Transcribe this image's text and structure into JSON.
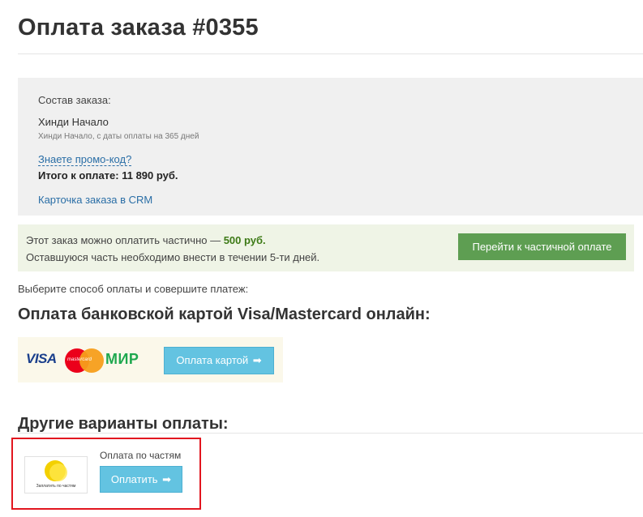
{
  "page": {
    "title": "Оплата заказа #0355"
  },
  "order": {
    "label": "Состав заказа:",
    "product_name": "Хинди Начало",
    "product_desc": "Хинди Начало, с даты оплаты на 365 дней",
    "promo_link": "Знаете промо-код?",
    "total": "Итого к оплате: 11 890 руб.",
    "crm_link": "Карточка заказа в CRM"
  },
  "partial": {
    "line1_text": "Этот заказ можно оплатить частично — ",
    "line1_amount": "500 руб.",
    "line2": "Оставшуюся часть необходимо внести в течении 5-ти дней.",
    "button": "Перейти к частичной оплате"
  },
  "choose_text": "Выберите способ оплаты и совершите платеж:",
  "card_payment": {
    "heading": "Оплата банковской картой Visa/Mastercard онлайн:",
    "visa_logo": "VISA",
    "mastercard_logo": "mastercard",
    "mir_logo": "МИР",
    "button": "Оплата картой",
    "button_icon": "arrow-right-icon"
  },
  "other_payment": {
    "heading": "Другие варианты оплаты:",
    "logo_text": "Заплатить по частям",
    "label": "Оплата по частям",
    "button": "Оплатить",
    "button_icon": "arrow-right-icon"
  },
  "colors": {
    "link": "#2a6ea6",
    "partial_button": "#5e9e52",
    "primary_button": "#63c3e1",
    "highlight_border": "#e2161f",
    "partial_amount": "#3d7a16"
  }
}
